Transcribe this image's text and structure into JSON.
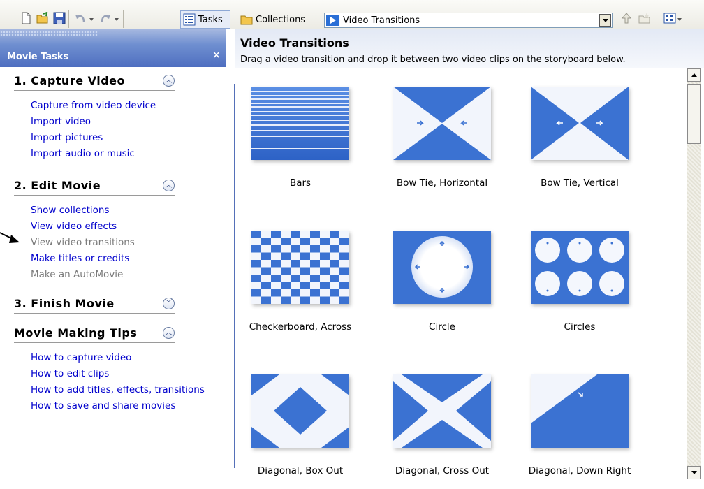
{
  "toolbar": {
    "tasks_label": "Tasks",
    "collections_label": "Collections",
    "combo_value": "Video Transitions"
  },
  "left_panel": {
    "title": "Movie Tasks",
    "close": "×",
    "sections": [
      {
        "title": "1. Capture Video",
        "state": "expanded",
        "links": [
          {
            "label": "Capture from video device",
            "enabled": true
          },
          {
            "label": "Import video",
            "enabled": true
          },
          {
            "label": "Import pictures",
            "enabled": true
          },
          {
            "label": "Import audio or music",
            "enabled": true
          }
        ]
      },
      {
        "title": "2. Edit Movie",
        "state": "expanded",
        "links": [
          {
            "label": "Show collections",
            "enabled": true
          },
          {
            "label": "View video effects",
            "enabled": true
          },
          {
            "label": "View video transitions",
            "enabled": false
          },
          {
            "label": "Make titles or credits",
            "enabled": true
          },
          {
            "label": "Make an AutoMovie",
            "enabled": false
          }
        ]
      },
      {
        "title": "3. Finish Movie",
        "state": "collapsed",
        "links": []
      },
      {
        "title": "Movie Making Tips",
        "state": "expanded",
        "links": [
          {
            "label": "How to capture video",
            "enabled": true
          },
          {
            "label": "How to edit clips",
            "enabled": true
          },
          {
            "label": "How to add titles, effects, transitions",
            "enabled": true
          },
          {
            "label": "How to save and share movies",
            "enabled": true
          }
        ]
      }
    ]
  },
  "content": {
    "title": "Video Transitions",
    "subtitle": "Drag a video transition and drop it between two video clips on the storyboard below.",
    "transitions": [
      {
        "label": "Bars"
      },
      {
        "label": "Bow Tie, Horizontal"
      },
      {
        "label": "Bow Tie, Vertical"
      },
      {
        "label": "Checkerboard, Across"
      },
      {
        "label": "Circle"
      },
      {
        "label": "Circles"
      },
      {
        "label": "Diagonal, Box Out"
      },
      {
        "label": "Diagonal, Cross Out"
      },
      {
        "label": "Diagonal, Down Right"
      }
    ]
  },
  "colors": {
    "accent": "#3a6fd0",
    "link": "#0000cc",
    "disabled": "#7a7a7a"
  }
}
